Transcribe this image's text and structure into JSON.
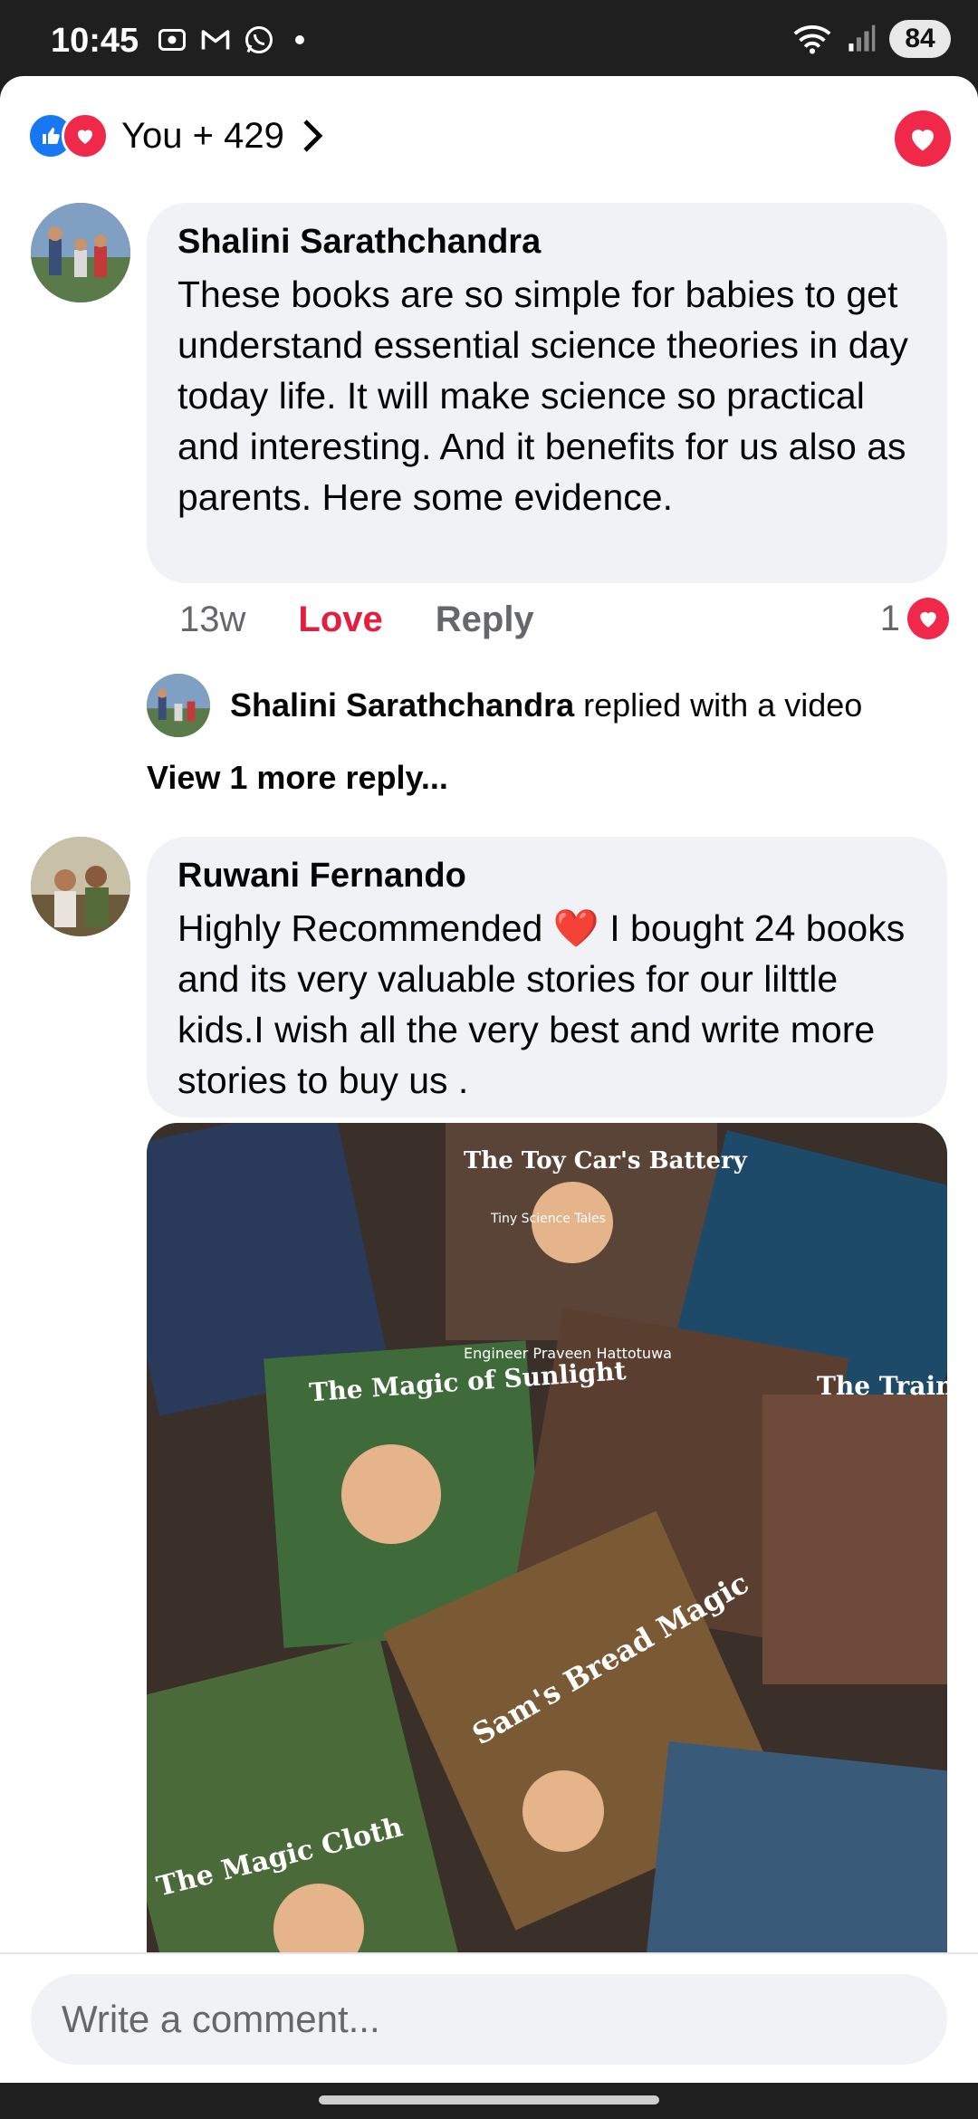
{
  "status_bar": {
    "time": "10:45",
    "battery": "84"
  },
  "reactions": {
    "summary": "You + 429"
  },
  "comments": [
    {
      "author": "Shalini Sarathchandra",
      "text": "These books are so simple for babies to get understand essential science theories in day today life. It will make science so practical and interesting. And it benefits for us also as parents. Here some evidence.",
      "time": "13w",
      "love_label": "Love",
      "reply_label": "Reply",
      "reaction_count": "1"
    },
    {
      "author": "Ruwani Fernando",
      "text_before": "Highly Recommended",
      "emoji": "❤️",
      "text_after": "I bought 24 books and its very valuable stories for our lilttle kids.I wish all the very best and write more stories to buy us ."
    }
  ],
  "reply_preview": {
    "name": "Shalini Sarathchandra",
    "suffix": "replied with a video",
    "view_more": "View 1 more reply..."
  },
  "photo": {
    "book_titles": [
      "The Toy Car's Battery",
      "The Magic of Sunlight",
      "Sam's Bread Magic",
      "The Magic Cloth",
      "The Train"
    ],
    "series_label": "Tiny Science Tales",
    "author_label": "Engineer Praveen Hattotuwa"
  },
  "composer": {
    "placeholder": "Write a comment..."
  },
  "colors": {
    "love": "#f0284a",
    "like": "#1877f2",
    "bubble": "#f0f2f5",
    "muted": "#65676b"
  }
}
